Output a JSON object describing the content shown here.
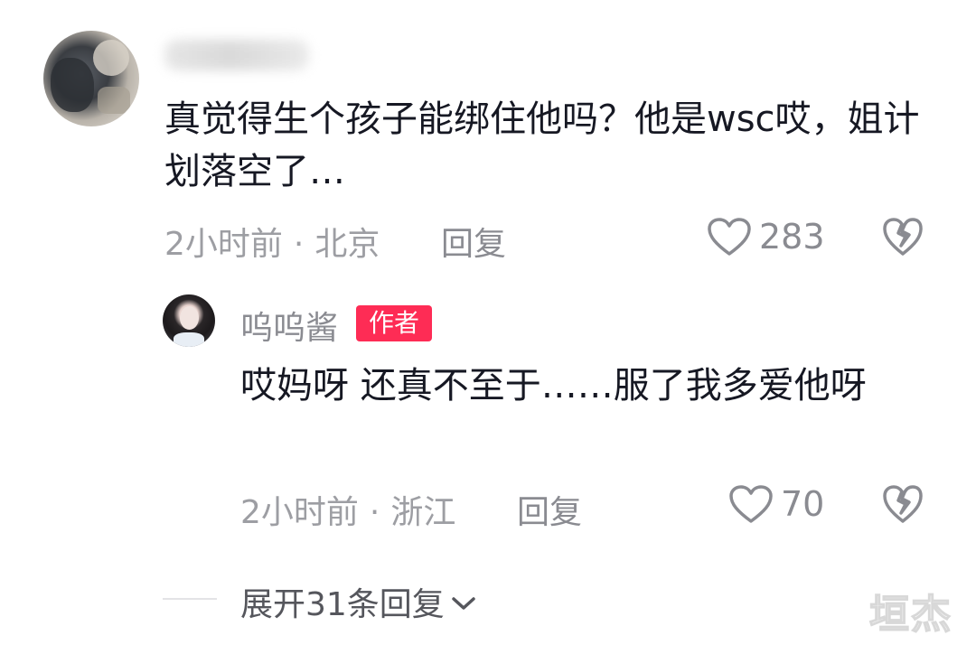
{
  "comment": {
    "text": "真觉得生个孩子能绑住他吗？他是wsc哎，姐计划落空了…",
    "time": "2小时前",
    "location": "北京",
    "reply_label": "回复",
    "likes": "283"
  },
  "reply": {
    "author": "呜呜酱",
    "badge": "作者",
    "text": "哎妈呀 还真不至于……服了我多爱他呀",
    "time": "2小时前",
    "location": "浙江",
    "reply_label": "回复",
    "likes": "70"
  },
  "expand": {
    "label": "展开31条回复"
  },
  "watermark": "垣杰",
  "icons": {
    "like": "heart-outline-icon",
    "dislike": "broken-heart-icon",
    "expand": "chevron-down-icon"
  },
  "colors": {
    "badge": "#fe2c55",
    "muted": "#8a8b91",
    "text": "#161823"
  }
}
